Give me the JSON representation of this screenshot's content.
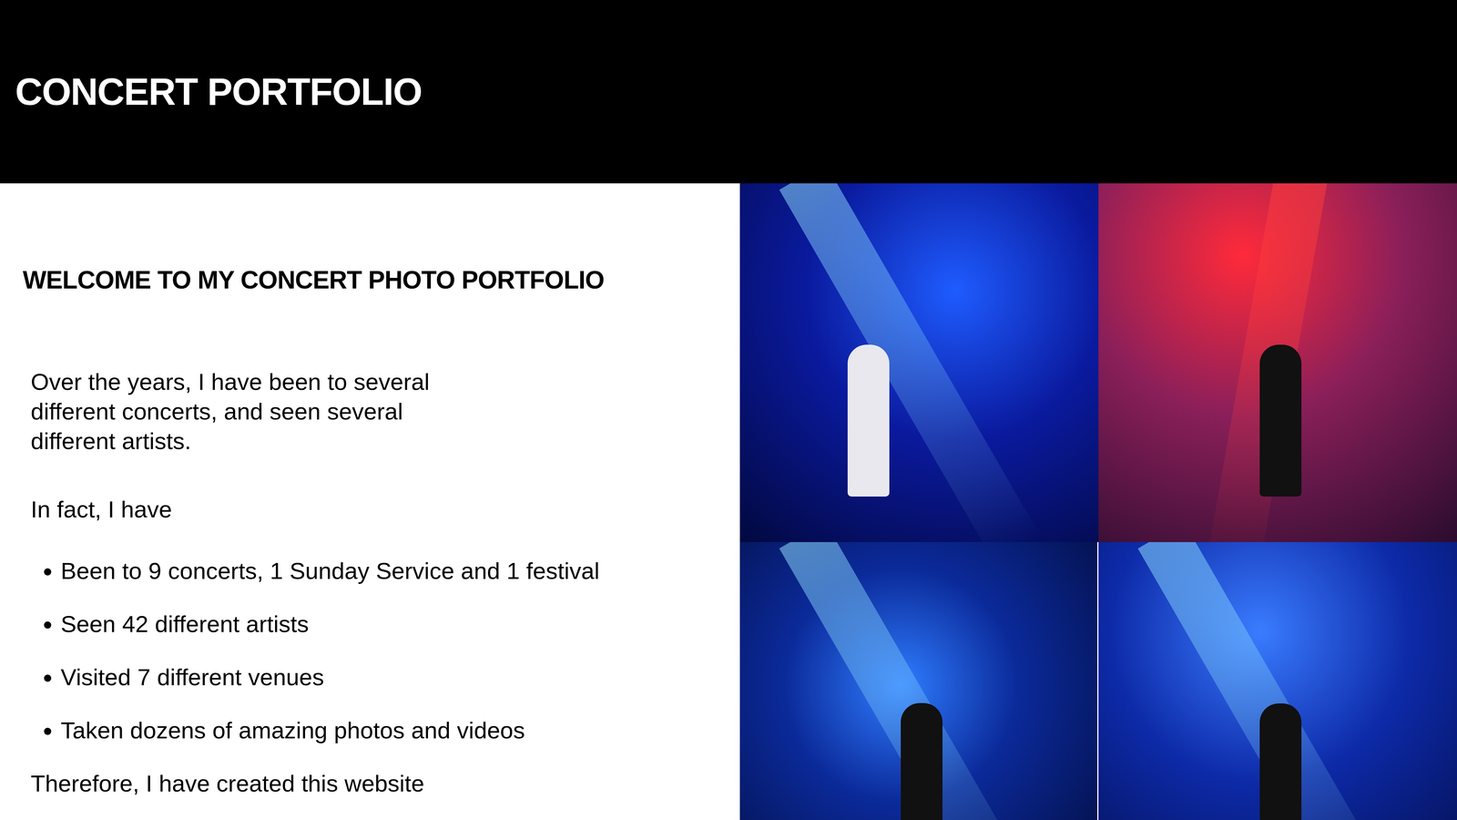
{
  "header": {
    "title": "CONCERT PORTFOLIO"
  },
  "intro": {
    "heading": "WELCOME TO MY CONCERT PHOTO PORTFOLIO",
    "paragraphs": [
      "Over the years, I have been to several different concerts, and seen several different artists.",
      "In fact, I have"
    ],
    "stats": [
      "Been to 9 concerts, 1 Sunday Service and 1 festival",
      "Seen 42 different artists",
      "Visited 7 different venues",
      "Taken dozens of amazing photos and videos"
    ],
    "closing": "Therefore, I have created this website"
  }
}
